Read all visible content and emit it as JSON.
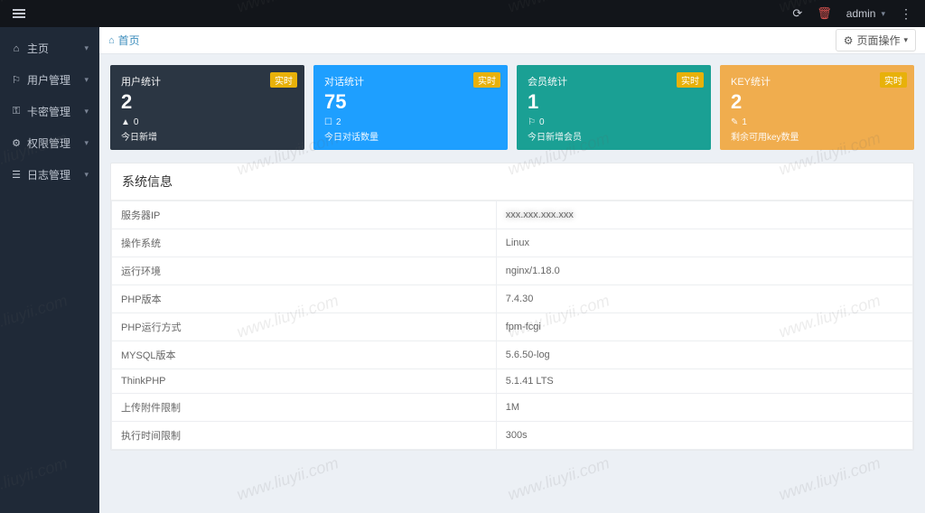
{
  "header": {
    "user": "admin"
  },
  "sidebar": {
    "items": [
      {
        "icon": "⌂",
        "label": "主页"
      },
      {
        "icon": "⚐",
        "label": "用户管理"
      },
      {
        "icon": "⚿",
        "label": "卡密管理"
      },
      {
        "icon": "⚙",
        "label": "权限管理"
      },
      {
        "icon": "☰",
        "label": "日志管理"
      }
    ]
  },
  "breadcrumb": {
    "home": "首页"
  },
  "page_ops": {
    "label": "页面操作"
  },
  "cards": [
    {
      "title": "用户统计",
      "value": "2",
      "sub_icon": "▲",
      "sub_val": "0",
      "subtxt": "今日新增",
      "badge": "实时"
    },
    {
      "title": "对话统计",
      "value": "75",
      "sub_icon": "☐",
      "sub_val": "2",
      "subtxt": "今日对话数量",
      "badge": "实时"
    },
    {
      "title": "会员统计",
      "value": "1",
      "sub_icon": "⚐",
      "sub_val": "0",
      "subtxt": "今日新增会员",
      "badge": "实时"
    },
    {
      "title": "KEY统计",
      "value": "2",
      "sub_icon": "✎",
      "sub_val": "1",
      "subtxt": "剩余可用key数量",
      "badge": "实时"
    }
  ],
  "sysinfo": {
    "title": "系统信息",
    "rows": [
      {
        "k": "服务器IP",
        "v": "",
        "blur": true
      },
      {
        "k": "操作系统",
        "v": "Linux"
      },
      {
        "k": "运行环境",
        "v": "nginx/1.18.0"
      },
      {
        "k": "PHP版本",
        "v": "7.4.30"
      },
      {
        "k": "PHP运行方式",
        "v": "fpm-fcgi"
      },
      {
        "k": "MYSQL版本",
        "v": "5.6.50-log"
      },
      {
        "k": "ThinkPHP",
        "v": "5.1.41 LTS"
      },
      {
        "k": "上传附件限制",
        "v": "1M"
      },
      {
        "k": "执行时间限制",
        "v": "300s"
      }
    ]
  },
  "watermark": "www.liuyii.com"
}
